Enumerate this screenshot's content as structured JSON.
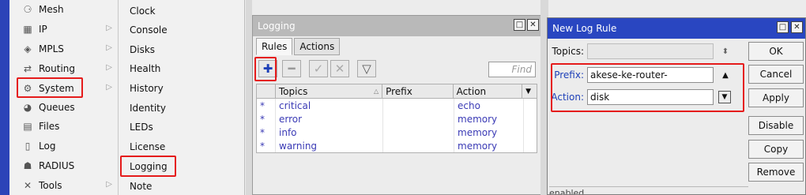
{
  "menu": {
    "items": [
      {
        "label": "Mesh",
        "icon": "mesh-icon",
        "glyph": "⚆",
        "arrow": false
      },
      {
        "label": "IP",
        "icon": "ip-icon",
        "glyph": "▦",
        "arrow": true
      },
      {
        "label": "MPLS",
        "icon": "mpls-icon",
        "glyph": "◈",
        "arrow": true
      },
      {
        "label": "Routing",
        "icon": "routing-icon",
        "glyph": "⇄",
        "arrow": true
      },
      {
        "label": "System",
        "icon": "system-gear-icon",
        "glyph": "⚙",
        "arrow": true
      },
      {
        "label": "Queues",
        "icon": "queues-icon",
        "glyph": "◕",
        "arrow": false
      },
      {
        "label": "Files",
        "icon": "files-icon",
        "glyph": "▤",
        "arrow": false
      },
      {
        "label": "Log",
        "icon": "log-icon",
        "glyph": "▯",
        "arrow": false
      },
      {
        "label": "RADIUS",
        "icon": "radius-icon",
        "glyph": "☗",
        "arrow": false
      },
      {
        "label": "Tools",
        "icon": "tools-icon",
        "glyph": "✕",
        "arrow": true
      }
    ]
  },
  "submenu": {
    "items": [
      "Clock",
      "Console",
      "Disks",
      "Health",
      "History",
      "Identity",
      "LEDs",
      "License",
      "Logging",
      "Note"
    ]
  },
  "logging": {
    "title": "Logging",
    "tabs": [
      "Rules",
      "Actions"
    ],
    "find_placeholder": "Find",
    "columns": [
      "Topics",
      "Prefix",
      "Action"
    ],
    "rows": [
      {
        "marker": "*",
        "topics": "critical",
        "prefix": "",
        "action": "echo"
      },
      {
        "marker": "*",
        "topics": "error",
        "prefix": "",
        "action": "memory"
      },
      {
        "marker": "*",
        "topics": "info",
        "prefix": "",
        "action": "memory"
      },
      {
        "marker": "*",
        "topics": "warning",
        "prefix": "",
        "action": "memory"
      }
    ]
  },
  "rule": {
    "title": "New Log Rule",
    "topics_label": "Topics:",
    "topics_value": "",
    "prefix_label": "Prefix:",
    "prefix_value": "akese-ke-router-",
    "action_label": "Action:",
    "action_value": "disk",
    "buttons": [
      "OK",
      "Cancel",
      "Apply",
      "Disable",
      "Copy",
      "Remove"
    ],
    "status": "enabled"
  },
  "colors": {
    "highlight": "#e51b1b",
    "title_active": "#2946c1",
    "title_inactive": "#b9b9b9"
  }
}
